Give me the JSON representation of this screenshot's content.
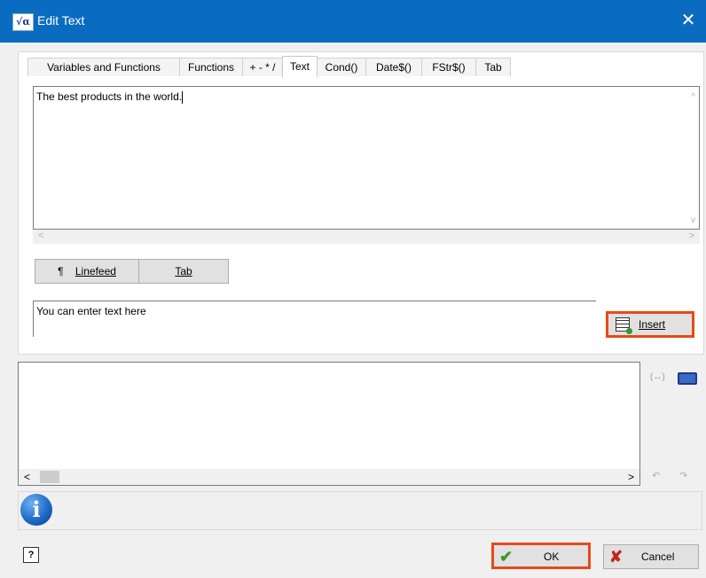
{
  "window": {
    "title": "Edit Text",
    "app_icon_text": "√α",
    "close_glyph": "✕"
  },
  "tabs": [
    {
      "label": "Variables and Functions",
      "active": false
    },
    {
      "label": "Functions",
      "active": false
    },
    {
      "label": "+ - * /",
      "active": false
    },
    {
      "label": "Text",
      "active": true
    },
    {
      "label": "Cond()",
      "active": false
    },
    {
      "label": "Date$()",
      "active": false
    },
    {
      "label": "FStr$()",
      "active": false
    },
    {
      "label": "Tab",
      "active": false
    }
  ],
  "editor": {
    "value": "The best products in the world."
  },
  "buttons": {
    "linefeed_icon": "¶",
    "linefeed_label": "Linefeed",
    "tab_label": "Tab",
    "insert_label": "Insert",
    "ok_label": "OK",
    "cancel_label": "Cancel",
    "help_glyph": "?"
  },
  "text_input": {
    "value": "You can enter text here"
  },
  "icons": {
    "wrap": "(↔)",
    "undo": "↶",
    "redo": "↷",
    "info": "i",
    "ok_check": "✔",
    "cancel_x": "✘",
    "scroll_left": "<",
    "scroll_right": ">",
    "scroll_up": "^",
    "scroll_down": "v"
  },
  "colors": {
    "titlebar": "#0a6cc0",
    "highlight": "#e64a19"
  }
}
